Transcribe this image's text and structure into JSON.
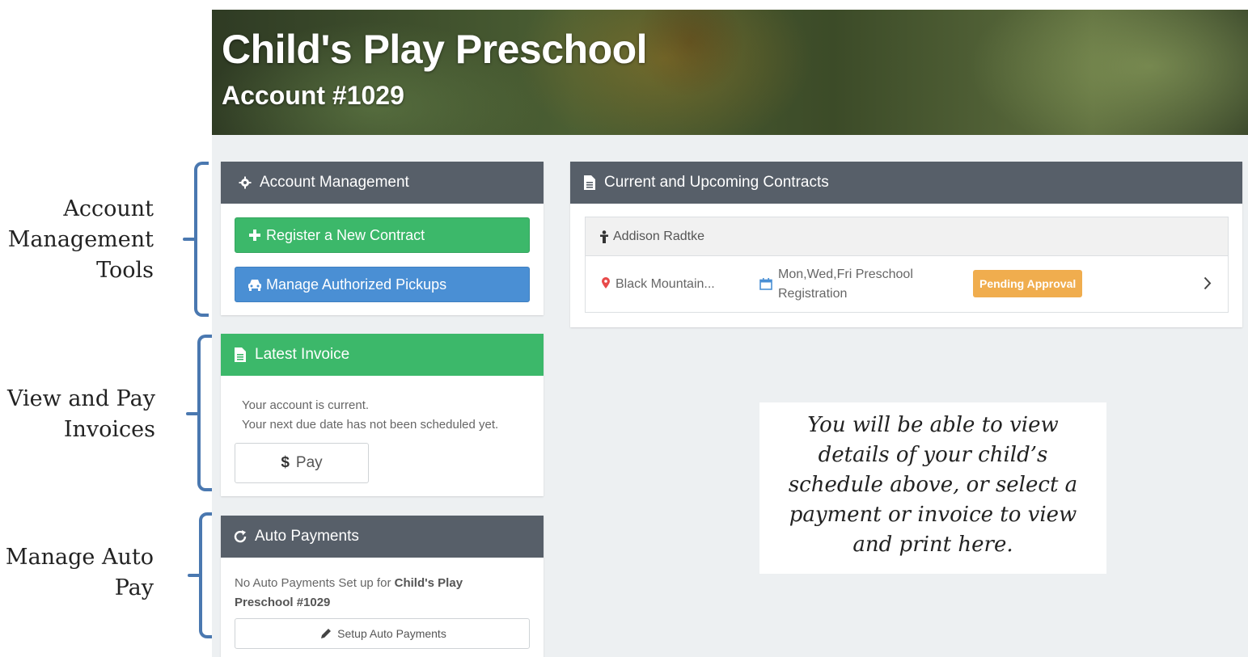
{
  "annotations": {
    "account_tools": [
      "Account",
      "Management",
      "Tools"
    ],
    "invoices": [
      "View and Pay",
      "Invoices"
    ],
    "auto_pay": [
      "Manage Auto",
      "Pay"
    ]
  },
  "banner": {
    "title": "Child's Play Preschool",
    "account": "Account #1029"
  },
  "account_management": {
    "title": "Account Management",
    "register_label": "Register a New Contract",
    "pickups_label": "Manage Authorized Pickups"
  },
  "latest_invoice": {
    "title": "Latest Invoice",
    "status_line1": "Your account is current.",
    "status_line2": "Your next due date has not been scheduled yet.",
    "pay_label": "Pay"
  },
  "auto_payments": {
    "title": "Auto Payments",
    "message_prefix": "No Auto Payments Set up for ",
    "message_bold_line1": "Child's Play",
    "message_bold_line2": "Preschool #1029",
    "setup_label": "Setup Auto Payments"
  },
  "contracts": {
    "title": "Current and Upcoming Contracts",
    "child_name": "Addison Radtke",
    "location": "Black Mountain...",
    "schedule_line1": "Mon,Wed,Fri Preschool",
    "schedule_line2": "Registration",
    "status": "Pending Approval"
  },
  "note": [
    "You will be able to view",
    "details of your child’s",
    "schedule above, or select a",
    "payment or invoice to view",
    "and print here."
  ],
  "icons": {
    "gear": "gear-icon",
    "plus": "plus-icon",
    "car": "car-icon",
    "document": "document-icon",
    "dollar": "dollar-icon",
    "refresh": "refresh-icon",
    "pencil": "pencil-icon",
    "person": "person-icon",
    "map_marker": "map-marker-icon",
    "calendar": "calendar-icon",
    "chevron_right": "chevron-right-icon"
  },
  "colors": {
    "header_dark": "#575f69",
    "green": "#3cb86a",
    "blue": "#4a8fd4",
    "badge_orange": "#f0ad4e",
    "bracket_blue": "#4a78b0",
    "content_bg": "#edf0f2"
  }
}
